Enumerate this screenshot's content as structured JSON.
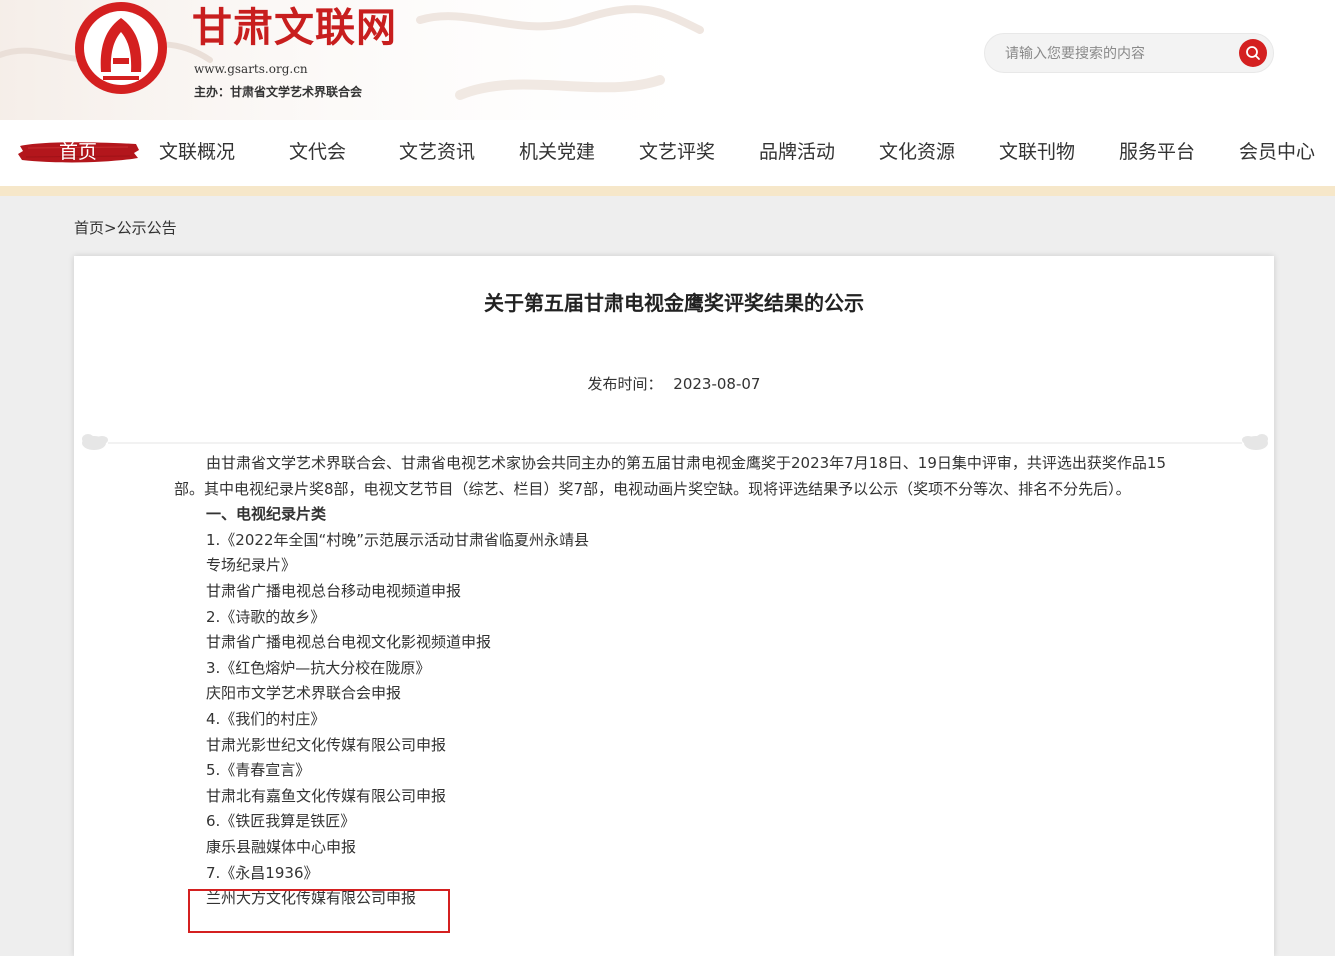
{
  "header": {
    "site_title": "甘肃文联网",
    "site_url": "www.gsarts.org.cn",
    "host": "主办：甘肃省文学艺术界联合会",
    "search_placeholder": "请输入您要搜索的内容",
    "logo_icon": "gsarts-logo-icon",
    "search_icon": "search-icon",
    "brand_color": "#c81e1e"
  },
  "nav": {
    "items": [
      {
        "label": "首页",
        "active": true
      },
      {
        "label": "文联概况"
      },
      {
        "label": "文代会"
      },
      {
        "label": "文艺资讯"
      },
      {
        "label": "机关党建"
      },
      {
        "label": "文艺评奖"
      },
      {
        "label": "品牌活动"
      },
      {
        "label": "文化资源"
      },
      {
        "label": "文联刊物"
      },
      {
        "label": "服务平台"
      },
      {
        "label": "会员中心"
      }
    ]
  },
  "breadcrumb": {
    "home": "首页",
    "separator": ">",
    "current": "公示公告"
  },
  "article": {
    "title": "关于第五届甘肃电视金鹰奖评奖结果的公示",
    "publish_label": "发布时间：",
    "publish_date": "2023-08-07",
    "intro": "由甘肃省文学艺术界联合会、甘肃省电视艺术家协会共同主办的第五届甘肃电视金鹰奖于2023年7月18日、19日集中评审，共评选出获奖作品15部。其中电视纪录片奖8部，电视文艺节目（综艺、栏目）奖7部，电视动画片奖空缺。现将评选结果予以公示（奖项不分等次、排名不分先后）。",
    "section1": "一、电视纪录片类",
    "lines": [
      "1.《2022年全国“村晚”示范展示活动甘肃省临夏州永靖县",
      "专场纪录片》",
      "甘肃省广播电视总台移动电视频道申报",
      "2.《诗歌的故乡》",
      "甘肃省广播电视总台电视文化影视频道申报",
      "3.《红色熔炉—抗大分校在陇原》",
      "庆阳市文学艺术界联合会申报",
      "4.《我们的村庄》",
      "甘肃光影世纪文化传媒有限公司申报",
      "5.《青春宣言》",
      "甘肃北有嘉鱼文化传媒有限公司申报",
      "6.《铁匠我算是铁匠》",
      "康乐县融媒体中心申报",
      "7.《永昌1936》",
      "兰州大方文化传媒有限公司申报"
    ]
  }
}
